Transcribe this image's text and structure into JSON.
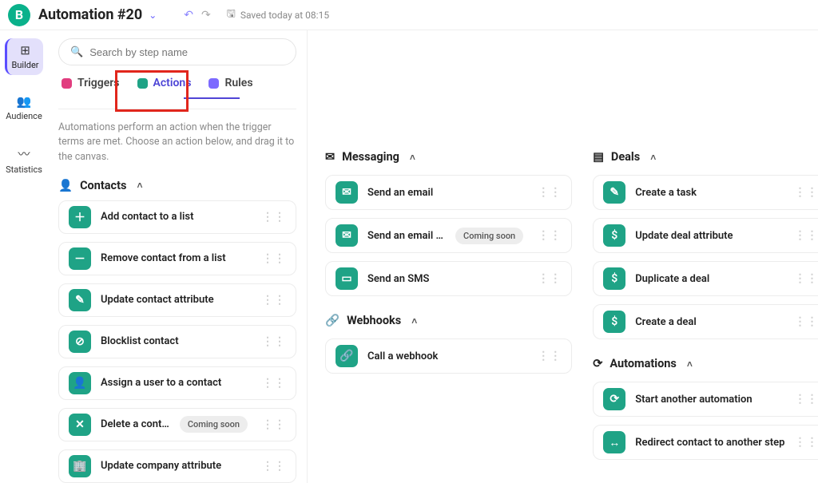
{
  "header": {
    "logo_letter": "B",
    "title": "Automation #20",
    "saved_text": "Saved today at 08:15"
  },
  "rail": {
    "builder": "Builder",
    "audience": "Audience",
    "statistics": "Statistics"
  },
  "search": {
    "placeholder": "Search by step name"
  },
  "tabs": {
    "triggers": "Triggers",
    "actions": "Actions",
    "rules": "Rules"
  },
  "description": "Automations perform an action when the trigger terms are met. Choose an action below, and drag it to the canvas.",
  "badges": {
    "coming_soon": "Coming soon"
  },
  "sections": {
    "contacts": {
      "title": "Contacts",
      "items": [
        {
          "label": "Add contact to a list"
        },
        {
          "label": "Remove contact from a list"
        },
        {
          "label": "Update contact attribute"
        },
        {
          "label": "Blocklist contact"
        },
        {
          "label": "Assign a user to a contact"
        },
        {
          "label": "Delete a contact",
          "coming_soon": true
        },
        {
          "label": "Update company attribute"
        }
      ]
    },
    "messaging": {
      "title": "Messaging",
      "items": [
        {
          "label": "Send an email"
        },
        {
          "label": "Send an email notifi…",
          "coming_soon": true
        },
        {
          "label": "Send an SMS"
        }
      ]
    },
    "webhooks": {
      "title": "Webhooks",
      "items": [
        {
          "label": "Call a webhook"
        }
      ]
    },
    "deals": {
      "title": "Deals",
      "items": [
        {
          "label": "Create a task"
        },
        {
          "label": "Update deal attribute"
        },
        {
          "label": "Duplicate a deal"
        },
        {
          "label": "Create a deal"
        }
      ]
    },
    "automations": {
      "title": "Automations",
      "items": [
        {
          "label": "Start another automation"
        },
        {
          "label": "Redirect contact to another step"
        }
      ]
    }
  }
}
